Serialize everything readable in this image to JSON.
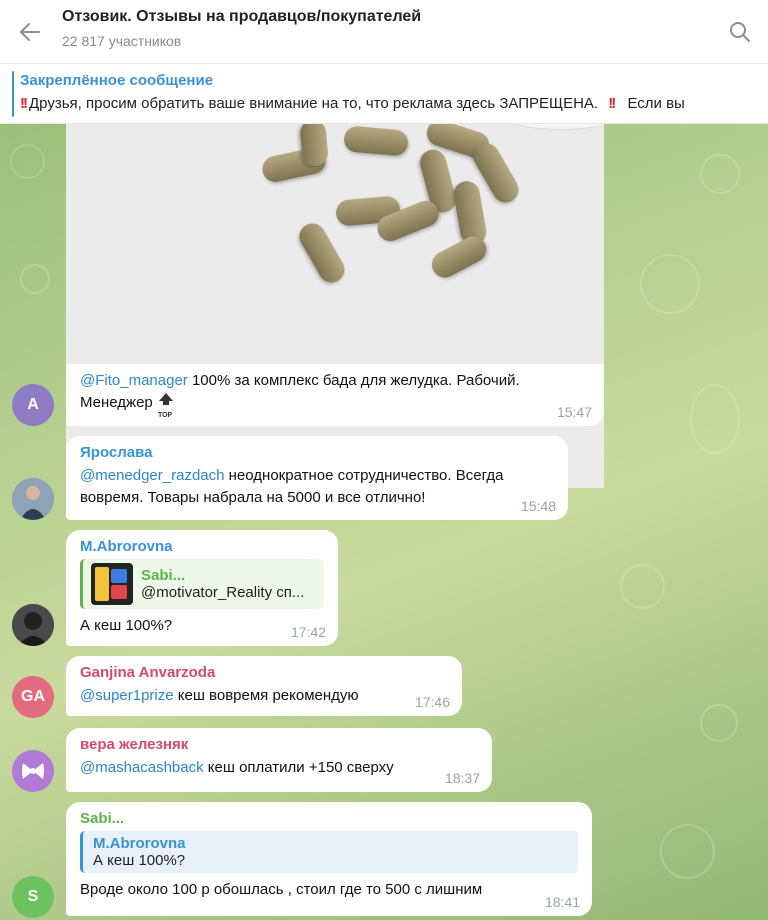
{
  "header": {
    "title": "Отзовик. Отзывы на продавцов/покупателей",
    "subtitle": "22 817 участников"
  },
  "pinned": {
    "title": "Закреплённое сообщение",
    "text": "Друзья, просим обратить ваше внимание на то, что реклама здесь ЗАПРЕЩЕНА.",
    "text_tail": "Если вы"
  },
  "messages": [
    {
      "mention": "@Fito_manager",
      "text": " 100% за комплекс бада для желудка. Рабочий. Менеджер",
      "time": "15:47",
      "avatar": "A",
      "avatar_color": "#8e7cc3"
    },
    {
      "sender": "Ярослава",
      "sender_color": "#3a92d6",
      "mention": "@menedger_razdach",
      "text": " неоднократное сотрудничество. Всегда вовремя. Товары набрала на 5000 и все отлично!",
      "time": "15:48"
    },
    {
      "sender": "M.Abrorovna",
      "sender_color": "#3a92d6",
      "reply_name": "Sabi...",
      "reply_text": "@motivator_Reality сп...",
      "text": "А кеш 100%?",
      "time": "17:42"
    },
    {
      "sender": "Ganjina Anvarzoda",
      "sender_color": "#d44a6c",
      "mention": "@super1prize",
      "text": " кеш вовремя рекомендую",
      "time": "17:46",
      "avatar": "GA",
      "avatar_color": "#e36a7f"
    },
    {
      "sender": "вера железняк",
      "sender_color": "#d44a6c",
      "mention": "@mashacashback",
      "text": " кеш оплатили +150 сверху",
      "time": "18:37"
    },
    {
      "sender": "Sabi...",
      "sender_color": "#5bb34d",
      "reply_name": "M.Abrorovna",
      "reply_text": "А кеш 100%?",
      "text": "Вроде около 100 р обошлась , стоил где то 500 с лишним",
      "time": "18:41",
      "avatar": "S",
      "avatar_color": "#6cc35e"
    }
  ],
  "icons": {
    "back": "arrow-left-icon",
    "search": "search-icon",
    "top_badge": "top-badge-icon"
  },
  "top_badge_label": "TOP"
}
